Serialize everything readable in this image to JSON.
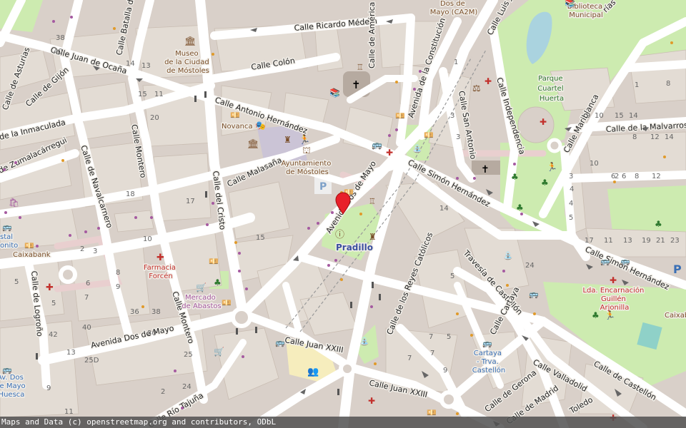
{
  "streets": [
    {
      "id": "ricardo-medem",
      "label": "Calle Ricardo Médem"
    },
    {
      "id": "juan-ocana",
      "label": "Calle Juan de Ocaña"
    },
    {
      "id": "colon",
      "label": "Calle Colón"
    },
    {
      "id": "antonio-hernandez",
      "label": "Calle Antonio Hernández"
    },
    {
      "id": "america",
      "label": "Calle de América"
    },
    {
      "id": "constitucion",
      "label": "Avenida de la Constitución"
    },
    {
      "id": "luis-jim",
      "label": "Calle Luis Jim"
    },
    {
      "id": "independencia",
      "label": "Calle Independencia"
    },
    {
      "id": "san-antonio",
      "label": "Calle San Antonio"
    },
    {
      "id": "simon-hernandez",
      "label": "Calle Simón Hernández"
    },
    {
      "id": "simon-hernandez-2",
      "label": "Calle Simón Hernández"
    },
    {
      "id": "dos-de-mayo",
      "label": "Avenida Dos de Mayo"
    },
    {
      "id": "dos-de-mayo-2",
      "label": "Avenida Dos de Mayo"
    },
    {
      "id": "malasana",
      "label": "Calle Malasaña"
    },
    {
      "id": "del-cristo",
      "label": "Calle del Cristo"
    },
    {
      "id": "montero",
      "label": "Calle Montero"
    },
    {
      "id": "montero-2",
      "label": "Calle Montero"
    },
    {
      "id": "navalcarnero",
      "label": "Calle de Navalcarnero"
    },
    {
      "id": "zumalacarregui",
      "label": "de Zumalacárregui"
    },
    {
      "id": "inmaculada",
      "label": "de la Inmaculada"
    },
    {
      "id": "gijon",
      "label": "Calle de Gijón"
    },
    {
      "id": "asturias",
      "label": "Calle de Asturias"
    },
    {
      "id": "batalla",
      "label": "Calle Batalla de B"
    },
    {
      "id": "logrono",
      "label": "Calle de Logroño"
    },
    {
      "id": "rio-tajuna",
      "label": "Calle Río Tajuña"
    },
    {
      "id": "juan-xxiii",
      "label": "Calle Juan XXIII"
    },
    {
      "id": "juan-xxiii-2",
      "label": "Calle Juan XXIII"
    },
    {
      "id": "reyes-catolicos",
      "label": "Calle de los Reyes Católicos"
    },
    {
      "id": "travesia-castellon",
      "label": "Travesía de Castellón"
    },
    {
      "id": "cartaya",
      "label": "Calle Cartaya"
    },
    {
      "id": "valladolid",
      "label": "Calle Valladolid"
    },
    {
      "id": "castellon",
      "label": "Calle de Castellón"
    },
    {
      "id": "gerona",
      "label": "Calle de Gerona"
    },
    {
      "id": "madrid",
      "label": "Calle de Madrid"
    },
    {
      "id": "toledo",
      "label": "Toledo"
    },
    {
      "id": "malvarrosa",
      "label": "Calle de la Malvarrosa"
    },
    {
      "id": "mariblanca",
      "label": "Calle Mariblanca"
    },
    {
      "id": "rias",
      "label": "rías"
    }
  ],
  "places": {
    "museo": [
      "Museo",
      "de la Ciudad",
      "de Móstoles"
    ],
    "novanca": "Novanca",
    "ayuntamiento": [
      "Ayuntamiento",
      "de Móstoles"
    ],
    "pradillo": "Pradillo",
    "caixabank_left": "Caixabank",
    "caixabank_right": "Caixab",
    "farmacia": [
      "Farmacia",
      "Forcén"
    ],
    "mercado": [
      "Mercado",
      "de Abastos"
    ],
    "biblioteca": [
      "Biblioteca",
      "Municipal"
    ],
    "dos_de_mayo_ca2m": [
      "Dos de",
      "Mayo (CA2M)"
    ],
    "parque": [
      "Parque",
      "Cuartel",
      "Huerta"
    ],
    "lda": [
      "Lda. Encarnación",
      "Guillén",
      "Arjonilla"
    ],
    "cartaya_stop": [
      "Cartaya",
      "- Trva.",
      "Castellón"
    ],
    "av_dos_stop": [
      "Av. Dos",
      "de Mayo",
      "Huesca"
    ],
    "postal": [
      "stal",
      "onito"
    ]
  },
  "house_numbers": [
    "38",
    "40",
    "14",
    "13",
    "15",
    "11",
    "18",
    "20",
    "17",
    "15",
    "14",
    "10",
    "2",
    "3",
    "5",
    "3",
    "1",
    "8",
    "9",
    "36",
    "38",
    "30",
    "40",
    "42",
    "5",
    "6",
    "7",
    "8",
    "9",
    "3",
    "4",
    "15",
    "14",
    "12",
    "10",
    "8",
    "6",
    "4",
    "2",
    "7",
    "9",
    "11",
    "5",
    "13",
    "17",
    "19",
    "21",
    "23",
    "25",
    "2",
    "9",
    "11",
    "13",
    "25D",
    "7",
    "10",
    "8",
    "6",
    "12",
    "14",
    "24",
    "24",
    "5",
    "3",
    "1",
    "7",
    "5"
  ],
  "parking_label": "P",
  "attribution": "Maps and Data (c) openstreetmap.org and contributors, ODbL",
  "colors": {
    "road": "#ffffff",
    "building": "#d9d0c9",
    "block": "#e0d9d2",
    "park": "#cdebb0",
    "plaza": "#dddde8",
    "water": "#aad3df",
    "marker": "#e8202a",
    "pedestrian": "#e9cfcf"
  }
}
